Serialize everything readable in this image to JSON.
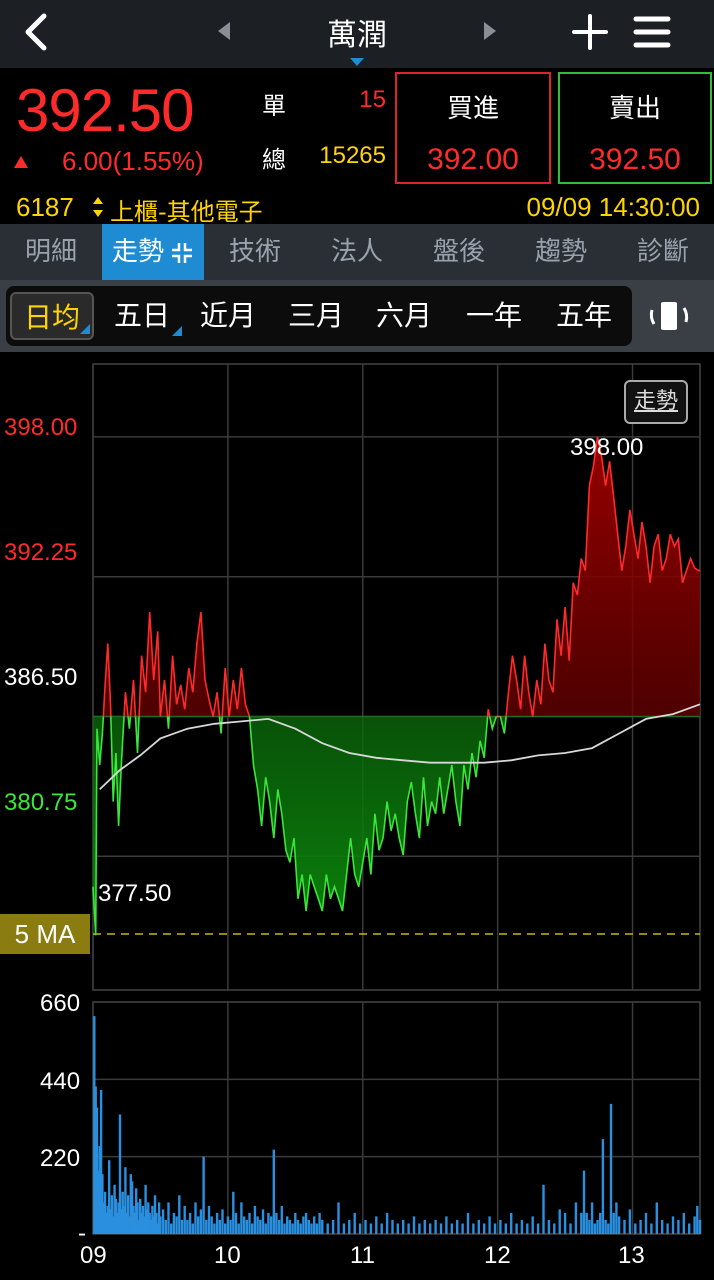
{
  "header": {
    "title": "萬潤"
  },
  "quote": {
    "price": "392.50",
    "change": "6.00(1.55%)",
    "single_label": "單",
    "single_volume": "15",
    "total_label": "總",
    "total_volume": "15265",
    "buy_label": "買進",
    "bid": "392.00",
    "sell_label": "賣出",
    "ask": "392.50",
    "code": "6187",
    "market": "上櫃-其他電子",
    "timestamp": "09/09 14:30:00",
    "colors": {
      "up": "#ff2a2a",
      "down": "#39e639",
      "highlight": "#ffd400"
    }
  },
  "tabs": [
    "明細",
    "走勢",
    "技術",
    "法人",
    "盤後",
    "趨勢",
    "診斷"
  ],
  "active_tab": "走勢",
  "periods": [
    "日均",
    "五日",
    "近月",
    "三月",
    "六月",
    "一年",
    "五年"
  ],
  "active_period": "日均",
  "chart_data": {
    "type": "line",
    "price_ticks_text": [
      "398.00",
      "392.25",
      "386.50",
      "380.75"
    ],
    "price_ticks": [
      398.0,
      392.25,
      386.5,
      380.75
    ],
    "reference_price": 386.5,
    "ylim": [
      375.25,
      401.0
    ],
    "high_label": "398.00",
    "low_label": "377.50",
    "trend_button": "走勢",
    "ma_label": "5 MA",
    "x_ticks": [
      "09",
      "10",
      "11",
      "12",
      "13"
    ],
    "xlim": [
      9.0,
      13.5
    ],
    "volume_ticks_text": [
      "660",
      "440",
      "220",
      "-"
    ],
    "volume_ticks": [
      660,
      440,
      220,
      0
    ],
    "volume_max": 660,
    "price": {
      "x": [
        9.0,
        9.02,
        9.03,
        9.05,
        9.07,
        9.09,
        9.11,
        9.13,
        9.15,
        9.17,
        9.19,
        9.21,
        9.24,
        9.27,
        9.3,
        9.33,
        9.36,
        9.39,
        9.42,
        9.45,
        9.48,
        9.5,
        9.53,
        9.56,
        9.59,
        9.62,
        9.65,
        9.68,
        9.71,
        9.74,
        9.77,
        9.8,
        9.83,
        9.86,
        9.89,
        9.92,
        9.95,
        9.98,
        10.01,
        10.04,
        10.07,
        10.1,
        10.13,
        10.16,
        10.19,
        10.22,
        10.25,
        10.28,
        10.31,
        10.34,
        10.37,
        10.4,
        10.43,
        10.46,
        10.49,
        10.52,
        10.55,
        10.58,
        10.61,
        10.64,
        10.67,
        10.7,
        10.73,
        10.76,
        10.79,
        10.82,
        10.85,
        10.88,
        10.91,
        10.94,
        10.97,
        11.0,
        11.03,
        11.06,
        11.09,
        11.12,
        11.15,
        11.18,
        11.21,
        11.24,
        11.27,
        11.3,
        11.33,
        11.36,
        11.39,
        11.42,
        11.45,
        11.48,
        11.51,
        11.54,
        11.57,
        11.6,
        11.63,
        11.66,
        11.69,
        11.72,
        11.75,
        11.78,
        11.81,
        11.84,
        11.87,
        11.9,
        11.93,
        11.96,
        11.99,
        12.02,
        12.05,
        12.08,
        12.11,
        12.14,
        12.17,
        12.2,
        12.23,
        12.26,
        12.29,
        12.32,
        12.35,
        12.38,
        12.41,
        12.44,
        12.47,
        12.5,
        12.53,
        12.56,
        12.59,
        12.62,
        12.65,
        12.68,
        12.71,
        12.74,
        12.77,
        12.8,
        12.83,
        12.86,
        12.89,
        12.92,
        12.95,
        12.98,
        13.01,
        13.04,
        13.07,
        13.1,
        13.13,
        13.16,
        13.19,
        13.22,
        13.25,
        13.28,
        13.31,
        13.34,
        13.37,
        13.4,
        13.43,
        13.46,
        13.49,
        13.5
      ],
      "y": [
        379.5,
        377.5,
        386.0,
        384.5,
        385.8,
        387.8,
        389.5,
        387.0,
        383.0,
        385.0,
        382.0,
        384.5,
        387.5,
        386.0,
        388.0,
        385.0,
        389.0,
        387.5,
        390.8,
        388.0,
        390.0,
        386.5,
        388.0,
        386.0,
        389.0,
        387.0,
        387.8,
        386.8,
        388.5,
        387.5,
        389.5,
        390.8,
        388.0,
        387.2,
        386.5,
        387.5,
        385.8,
        388.5,
        386.5,
        388.0,
        386.8,
        388.5,
        387.0,
        386.5,
        384.5,
        383.5,
        382.0,
        384.0,
        383.0,
        381.5,
        383.5,
        382.5,
        381.0,
        380.5,
        381.5,
        379.0,
        380.0,
        378.5,
        380.0,
        379.5,
        379.0,
        378.5,
        380.0,
        379.0,
        379.5,
        379.0,
        378.5,
        380.0,
        381.5,
        380.0,
        379.5,
        380.5,
        381.5,
        380.0,
        382.5,
        381.0,
        381.5,
        383.0,
        381.8,
        382.5,
        381.5,
        380.8,
        383.0,
        383.8,
        382.5,
        381.5,
        384.0,
        382.0,
        383.0,
        382.5,
        384.0,
        382.5,
        383.5,
        384.5,
        383.0,
        382.0,
        384.5,
        383.5,
        385.0,
        384.0,
        385.5,
        384.8,
        386.8,
        386.0,
        386.5,
        386.5,
        385.8,
        387.5,
        389.0,
        388.0,
        386.8,
        389.0,
        387.5,
        386.5,
        388.0,
        387.0,
        389.5,
        388.0,
        387.5,
        390.5,
        389.0,
        391.0,
        388.8,
        392.0,
        391.5,
        393.0,
        392.5,
        396.0,
        396.8,
        398.0,
        397.2,
        396.0,
        397.0,
        395.5,
        394.0,
        392.5,
        393.5,
        395.0,
        394.0,
        393.0,
        394.5,
        393.5,
        392.0,
        393.5,
        394.0,
        392.5,
        393.0,
        394.0,
        393.5,
        393.8,
        392.0,
        392.5,
        393.0,
        392.6,
        392.5,
        392.5
      ],
      "line_color_up": "#ff2a2a",
      "line_color_down": "#39e639"
    },
    "average": {
      "x": [
        9.05,
        9.2,
        9.35,
        9.5,
        9.7,
        9.9,
        10.1,
        10.3,
        10.5,
        10.7,
        10.9,
        11.1,
        11.3,
        11.5,
        11.7,
        11.9,
        12.1,
        12.3,
        12.5,
        12.7,
        12.9,
        13.1,
        13.3,
        13.5
      ],
      "y": [
        383.5,
        384.3,
        384.9,
        385.6,
        386.0,
        386.2,
        386.3,
        386.4,
        386.0,
        385.4,
        385.0,
        384.8,
        384.7,
        384.6,
        384.6,
        384.6,
        384.7,
        384.9,
        385.0,
        385.2,
        385.8,
        386.4,
        386.6,
        387.0
      ],
      "color": "#d8d8d8"
    },
    "volume": {
      "color": "#2a8fdf",
      "x": [
        9.01,
        9.02,
        9.03,
        9.04,
        9.05,
        9.06,
        9.07,
        9.08,
        9.09,
        9.1,
        9.11,
        9.12,
        9.13,
        9.14,
        9.15,
        9.16,
        9.17,
        9.18,
        9.19,
        9.2,
        9.21,
        9.22,
        9.23,
        9.24,
        9.25,
        9.26,
        9.27,
        9.28,
        9.29,
        9.3,
        9.31,
        9.32,
        9.33,
        9.34,
        9.35,
        9.36,
        9.37,
        9.38,
        9.39,
        9.4,
        9.41,
        9.42,
        9.43,
        9.44,
        9.45,
        9.46,
        9.47,
        9.48,
        9.49,
        9.5,
        9.52,
        9.54,
        9.56,
        9.58,
        9.6,
        9.62,
        9.64,
        9.66,
        9.68,
        9.7,
        9.72,
        9.74,
        9.76,
        9.78,
        9.8,
        9.82,
        9.84,
        9.86,
        9.88,
        9.9,
        9.92,
        9.94,
        9.96,
        9.98,
        10.0,
        10.02,
        10.04,
        10.06,
        10.08,
        10.1,
        10.12,
        10.14,
        10.16,
        10.18,
        10.2,
        10.22,
        10.24,
        10.26,
        10.28,
        10.3,
        10.32,
        10.34,
        10.36,
        10.38,
        10.4,
        10.42,
        10.44,
        10.46,
        10.48,
        10.5,
        10.52,
        10.54,
        10.56,
        10.58,
        10.6,
        10.62,
        10.64,
        10.66,
        10.68,
        10.7,
        10.74,
        10.78,
        10.82,
        10.86,
        10.9,
        10.94,
        10.98,
        11.02,
        11.06,
        11.1,
        11.14,
        11.18,
        11.22,
        11.26,
        11.3,
        11.34,
        11.38,
        11.42,
        11.46,
        11.5,
        11.54,
        11.58,
        11.62,
        11.66,
        11.7,
        11.74,
        11.78,
        11.82,
        11.86,
        11.9,
        11.94,
        11.98,
        12.02,
        12.06,
        12.1,
        12.14,
        12.18,
        12.22,
        12.26,
        12.3,
        12.34,
        12.38,
        12.42,
        12.46,
        12.5,
        12.54,
        12.58,
        12.62,
        12.64,
        12.66,
        12.68,
        12.7,
        12.72,
        12.74,
        12.76,
        12.78,
        12.8,
        12.82,
        12.84,
        12.86,
        12.88,
        12.9,
        12.94,
        12.98,
        13.02,
        13.06,
        13.1,
        13.14,
        13.18,
        13.22,
        13.26,
        13.3,
        13.34,
        13.38,
        13.42,
        13.46,
        13.48,
        13.5
      ],
      "values": [
        620,
        420,
        360,
        180,
        250,
        410,
        170,
        90,
        120,
        60,
        80,
        210,
        70,
        110,
        50,
        140,
        100,
        60,
        90,
        340,
        70,
        120,
        80,
        190,
        60,
        110,
        50,
        170,
        150,
        80,
        60,
        130,
        90,
        40,
        100,
        60,
        80,
        50,
        140,
        70,
        90,
        60,
        40,
        80,
        50,
        110,
        60,
        30,
        90,
        50,
        70,
        40,
        90,
        30,
        60,
        50,
        110,
        40,
        80,
        40,
        60,
        30,
        90,
        50,
        70,
        220,
        40,
        80,
        50,
        30,
        60,
        40,
        70,
        30,
        50,
        40,
        120,
        60,
        30,
        90,
        50,
        40,
        60,
        30,
        80,
        50,
        40,
        70,
        30,
        60,
        50,
        240,
        60,
        40,
        80,
        30,
        50,
        40,
        30,
        60,
        40,
        30,
        50,
        60,
        40,
        30,
        50,
        30,
        60,
        40,
        30,
        40,
        90,
        30,
        40,
        60,
        30,
        40,
        30,
        50,
        30,
        60,
        40,
        30,
        40,
        30,
        50,
        30,
        40,
        30,
        40,
        30,
        50,
        30,
        40,
        30,
        60,
        30,
        40,
        30,
        50,
        30,
        40,
        30,
        60,
        30,
        40,
        30,
        50,
        30,
        140,
        40,
        30,
        70,
        60,
        30,
        90,
        60,
        180,
        60,
        40,
        90,
        30,
        40,
        60,
        270,
        40,
        30,
        370,
        60,
        90,
        50,
        40,
        70,
        30,
        40,
        60,
        30,
        90,
        40,
        30,
        50,
        40,
        60,
        30,
        50,
        80,
        40,
        660
      ]
    }
  }
}
